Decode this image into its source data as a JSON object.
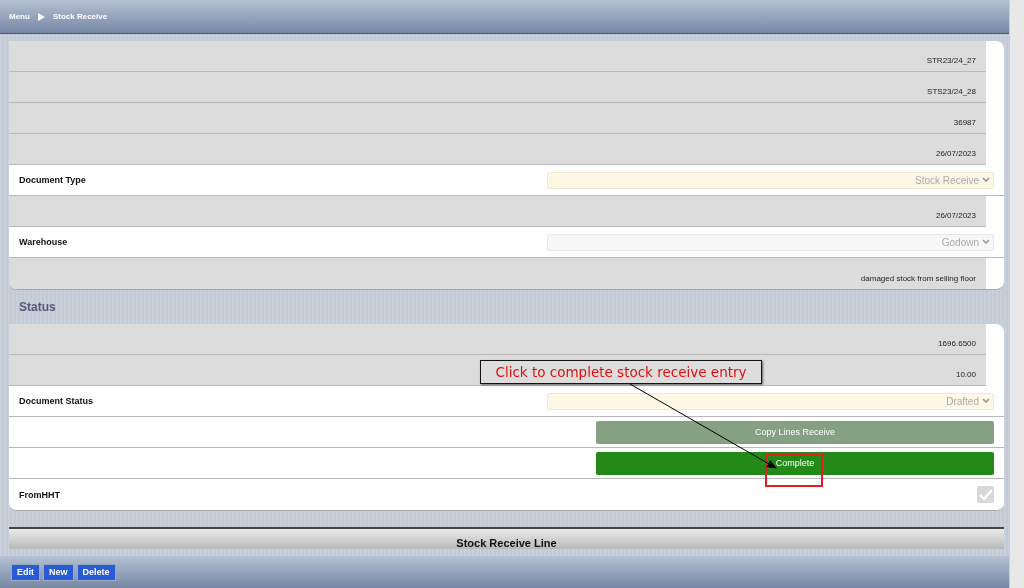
{
  "breadcrumb": [
    "Menu",
    "Stock Receive"
  ],
  "main_fields": [
    {
      "kind": "readonly",
      "value": "STR23/24_27"
    },
    {
      "kind": "readonly",
      "value": "STS23/24_28"
    },
    {
      "kind": "readonly",
      "value": "36987"
    },
    {
      "kind": "readonly",
      "value": "26/07/2023"
    },
    {
      "kind": "select",
      "label": "Document Type",
      "value": "Stock Receive",
      "mandatory": true
    },
    {
      "kind": "readonly",
      "value": "26/07/2023"
    },
    {
      "kind": "select",
      "label": "Warehouse",
      "value": "Godown",
      "mandatory": false
    },
    {
      "kind": "readonly",
      "value": "damaged stock from selling floor"
    }
  ],
  "status_section": {
    "title": "Status",
    "fields": [
      {
        "kind": "readonly",
        "value": "1696.6500"
      },
      {
        "kind": "readonly",
        "value": "10.00"
      },
      {
        "kind": "select",
        "label": "Document Status",
        "value": "Drafted",
        "mandatory": true
      },
      {
        "kind": "button",
        "label": "Copy Lines Receive",
        "disabled": true
      },
      {
        "kind": "button",
        "label": "Complete",
        "disabled": false
      },
      {
        "kind": "checkbox",
        "label": "FromHHT",
        "checked": true
      }
    ]
  },
  "lines_tab": {
    "title": "Stock Receive Line"
  },
  "footer_buttons": [
    "Edit",
    "New",
    "Delete"
  ],
  "annotation": {
    "text": "Click to complete stock receive entry"
  }
}
